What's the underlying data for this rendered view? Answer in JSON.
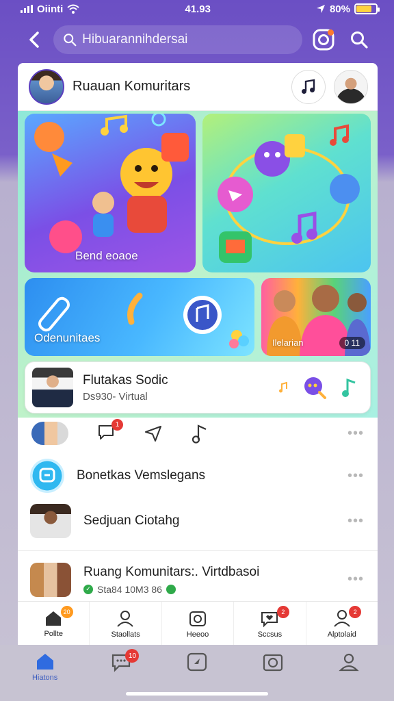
{
  "status": {
    "carrier": "Oiinti",
    "time": "41.93",
    "battery": "80%"
  },
  "app_bar": {
    "search_placeholder": "Hibuarannihdersai"
  },
  "header": {
    "title": "Ruauan Komuritars"
  },
  "tiles": [
    {
      "label": "Bend eoaoe"
    },
    {
      "label": ""
    },
    {
      "label": "Odenunitaes"
    },
    {
      "label": "Ilelarian",
      "time": "0 11"
    }
  ],
  "featured": {
    "title": "Flutakas Sodic",
    "subtitle": "Ds930- Virtual"
  },
  "action_row": {
    "message_count": "1"
  },
  "list": [
    {
      "title": "Bonetkas Vemslegans"
    },
    {
      "title": "Sedjuan Ciotahg"
    },
    {
      "title": "Ruang Komunitars:. Virtdbasoi",
      "subtitle": "Sta84 10M3 86"
    }
  ],
  "card_tabs": [
    {
      "label": "Pollte",
      "badge": "20",
      "badge_color": "#ff9a1f"
    },
    {
      "label": "Staollats",
      "badge": "",
      "badge_color": ""
    },
    {
      "label": "Heeoo",
      "badge": "",
      "badge_color": ""
    },
    {
      "label": "Sccsus",
      "badge": "2",
      "badge_color": "#e53935"
    },
    {
      "label": "Alptolaid",
      "badge": "2",
      "badge_color": "#e53935"
    }
  ],
  "bottom_nav": [
    {
      "label": "Hiatons",
      "badge": ""
    },
    {
      "label": "",
      "badge": "10"
    },
    {
      "label": "",
      "badge": ""
    },
    {
      "label": "",
      "badge": ""
    },
    {
      "label": "",
      "badge": ""
    }
  ],
  "colors": {
    "brand_purple": "#6b4fc4",
    "accent_orange": "#ff7a2e",
    "badge_red": "#e53935"
  }
}
